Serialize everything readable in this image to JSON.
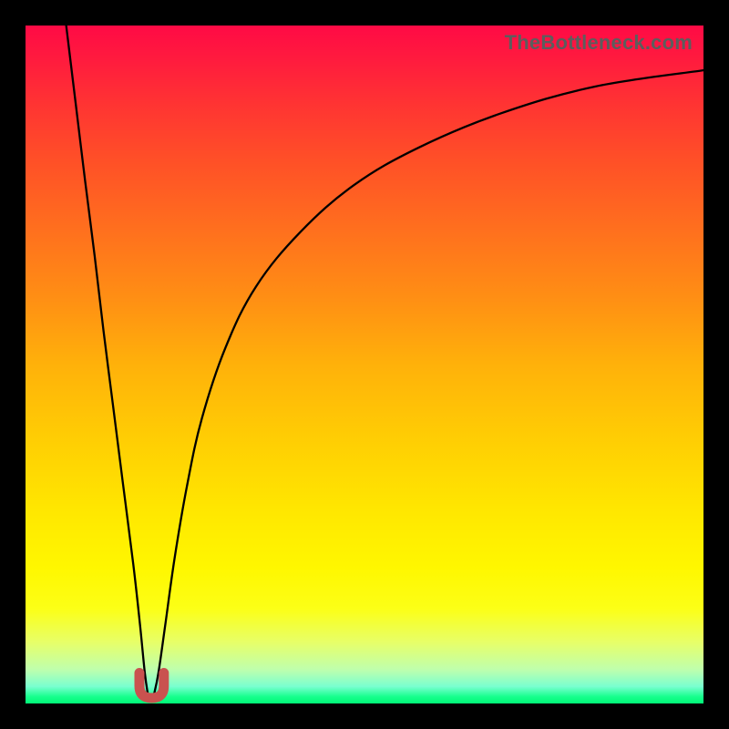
{
  "watermark": "TheBottleneck.com",
  "colors": {
    "frame": "#000000",
    "curve": "#000000",
    "marker": "#c9524f",
    "grad_top": "#ff0a45",
    "grad_bottom": "#00f876"
  },
  "chart_data": {
    "type": "line",
    "title": "",
    "xlabel": "",
    "ylabel": "",
    "xlim": [
      0,
      100
    ],
    "ylim": [
      0,
      100
    ],
    "grid": false,
    "legend": false,
    "description": "Bottleneck-style curve. Two branches drop steeply toward a single minimum near x≈18, y≈0, then the right branch rises asymptotically toward y≈100. Color gradient encodes the same quantity: red=high at top, green=low at bottom.",
    "series": [
      {
        "name": "left-branch",
        "x": [
          6.0,
          7.4,
          8.8,
          10.2,
          11.5,
          12.9,
          14.3,
          15.9,
          16.9,
          17.6,
          18.1
        ],
        "y": [
          100,
          88.5,
          77.0,
          66.0,
          55.0,
          44.0,
          33.0,
          20.5,
          11.5,
          4.5,
          1.0
        ]
      },
      {
        "name": "right-branch",
        "x": [
          18.9,
          19.6,
          20.6,
          22.0,
          23.8,
          26.0,
          29.5,
          34.0,
          40.5,
          48.5,
          58.0,
          70.0,
          84.0,
          100.0
        ],
        "y": [
          1.1,
          4.5,
          11.5,
          21.5,
          32.0,
          42.0,
          52.5,
          61.5,
          69.5,
          76.5,
          82.0,
          87.0,
          91.0,
          93.4
        ]
      }
    ],
    "marker": {
      "name": "dip-marker",
      "shape": "U",
      "color": "#c9524f",
      "x_range": [
        16.8,
        20.4
      ],
      "y_range": [
        0.0,
        4.5
      ]
    }
  }
}
